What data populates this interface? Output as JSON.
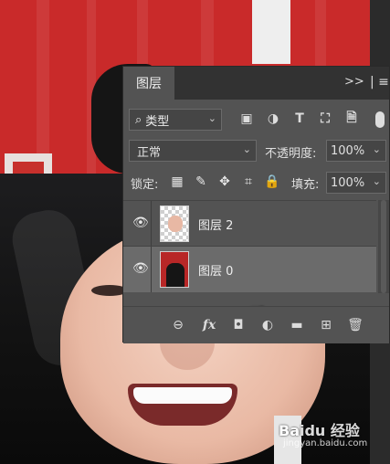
{
  "panel": {
    "tab_title": "图层",
    "collapse_icon": "double-chevron-right-icon",
    "menu_icon": "menu-icon"
  },
  "filter": {
    "kind_label": "类型",
    "icons": [
      "image-filter-icon",
      "adjustment-filter-icon",
      "type-filter-icon",
      "shape-filter-icon",
      "smart-object-filter-icon"
    ]
  },
  "blend": {
    "mode": "正常",
    "opacity_label": "不透明度:",
    "opacity_value": "100%"
  },
  "lock": {
    "label": "锁定:",
    "icons": [
      "lock-transparent-pixels-icon",
      "lock-image-pixels-icon",
      "lock-position-icon",
      "lock-artboard-icon",
      "lock-all-icon"
    ],
    "fill_label": "填充:",
    "fill_value": "100%"
  },
  "layers": [
    {
      "name": "图层 2",
      "visible": true,
      "selected": false
    },
    {
      "name": "图层 0",
      "visible": true,
      "selected": true
    }
  ],
  "footer_icons": [
    "link-layers-icon",
    "fx-icon",
    "add-mask-icon",
    "new-adjustment-layer-icon",
    "new-group-icon",
    "new-layer-icon",
    "delete-layer-icon"
  ],
  "watermark": {
    "brand": "Baidu 经验",
    "url": "jingyan.baidu.com"
  }
}
